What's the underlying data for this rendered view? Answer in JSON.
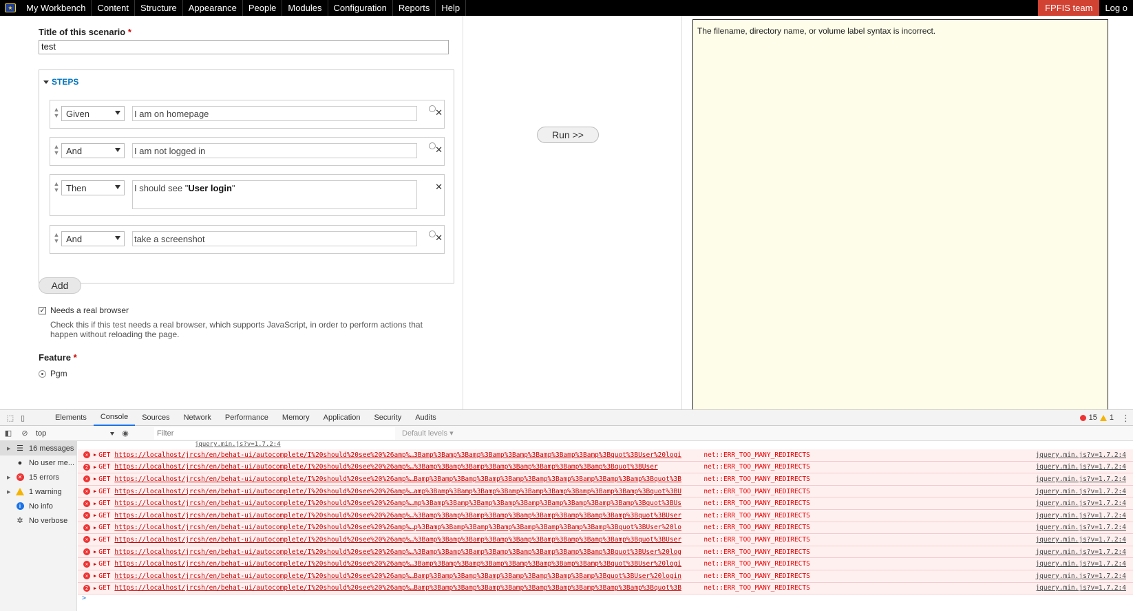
{
  "toolbar": {
    "items": [
      "My Workbench",
      "Content",
      "Structure",
      "Appearance",
      "People",
      "Modules",
      "Configuration",
      "Reports",
      "Help"
    ],
    "team": "FPFIS team",
    "logout": "Log o"
  },
  "form": {
    "title_label": "Title of this scenario",
    "required_mark": "*",
    "title_value": "test",
    "steps_legend": "STEPS",
    "steps": [
      {
        "keyword": "Given",
        "text": "I am on homepage"
      },
      {
        "keyword": "And",
        "text": "I am not logged in"
      },
      {
        "keyword": "Then",
        "text_before": "I should see \"",
        "text_bold": "User login",
        "text_after": "\""
      },
      {
        "keyword": "And",
        "text": "take a screenshot"
      }
    ],
    "add_label": "Add",
    "browser_check_label": "Needs a real browser",
    "browser_desc": "Check this if this test needs a real browser, which supports JavaScript, in order to perform actions that happen without reloading the page.",
    "feature_label": "Feature",
    "feature_option": "Pgm"
  },
  "run_label": "Run >>",
  "output_text": "The filename, directory name, or volume label syntax is incorrect.",
  "devtools": {
    "tabs": [
      "Elements",
      "Console",
      "Sources",
      "Network",
      "Performance",
      "Memory",
      "Application",
      "Security",
      "Audits"
    ],
    "active_tab": "Console",
    "error_count": "15",
    "warning_count": "1",
    "context": "top",
    "filter_placeholder": "Filter",
    "levels": "Default levels ▾",
    "sidebar": [
      {
        "label": "16 messages",
        "icon": "list-icon"
      },
      {
        "label": "No user me...",
        "icon": "user-icon"
      },
      {
        "label": "15 errors",
        "icon": "error-icon"
      },
      {
        "label": "1 warning",
        "icon": "warning-icon"
      },
      {
        "label": "No info",
        "icon": "info-icon"
      },
      {
        "label": "No verbose",
        "icon": "gear-icon"
      }
    ],
    "top_link": "jquery.min.js?v=1.7.2:4",
    "log": [
      {
        "badge": "",
        "url": "https://localhost/jrcsh/en/behat-ui/autocomplete/I%20should%20see%20%26amp%…3Bamp%3Bamp%3Bamp%3Bamp%3Bamp%3Bamp%3Bamp%3Bamp%3Bquot%3BUser%20logi",
        "error": "net::ERR_TOO_MANY_REDIRECTS",
        "src": "jquery.min.js?v=1.7.2:4"
      },
      {
        "badge": "2",
        "url": "https://localhost/jrcsh/en/behat-ui/autocomplete/I%20should%20see%20%26amp%…%3Bamp%3Bamp%3Bamp%3Bamp%3Bamp%3Bamp%3Bamp%3Bamp%3Bquot%3BUser",
        "error": "net::ERR_TOO_MANY_REDIRECTS",
        "src": "jquery.min.js?v=1.7.2:4"
      },
      {
        "badge": "",
        "url": "https://localhost/jrcsh/en/behat-ui/autocomplete/I%20should%20see%20%26amp%…Bamp%3Bamp%3Bamp%3Bamp%3Bamp%3Bamp%3Bamp%3Bamp%3Bamp%3Bamp%3Bquot%3B",
        "error": "net::ERR_TOO_MANY_REDIRECTS",
        "src": "jquery.min.js?v=1.7.2:4"
      },
      {
        "badge": "",
        "url": "https://localhost/jrcsh/en/behat-ui/autocomplete/I%20should%20see%20%26amp%…amp%3Bamp%3Bamp%3Bamp%3Bamp%3Bamp%3Bamp%3Bamp%3Bamp%3Bamp%3Bquot%3BU",
        "error": "net::ERR_TOO_MANY_REDIRECTS",
        "src": "jquery.min.js?v=1.7.2:4"
      },
      {
        "badge": "",
        "url": "https://localhost/jrcsh/en/behat-ui/autocomplete/I%20should%20see%20%26amp%…mp%3Bamp%3Bamp%3Bamp%3Bamp%3Bamp%3Bamp%3Bamp%3Bamp%3Bamp%3Bquot%3BUs",
        "error": "net::ERR_TOO_MANY_REDIRECTS",
        "src": "jquery.min.js?v=1.7.2:4"
      },
      {
        "badge": "",
        "url": "https://localhost/jrcsh/en/behat-ui/autocomplete/I%20should%20see%20%26amp%…%3Bamp%3Bamp%3Bamp%3Bamp%3Bamp%3Bamp%3Bamp%3Bamp%3Bamp%3Bquot%3BUser",
        "error": "net::ERR_TOO_MANY_REDIRECTS",
        "src": "jquery.min.js?v=1.7.2:4"
      },
      {
        "badge": "",
        "url": "https://localhost/jrcsh/en/behat-ui/autocomplete/I%20should%20see%20%26amp%…p%3Bamp%3Bamp%3Bamp%3Bamp%3Bamp%3Bamp%3Bamp%3Bamp%3Bquot%3BUser%20lo",
        "error": "net::ERR_TOO_MANY_REDIRECTS",
        "src": "jquery.min.js?v=1.7.2:4"
      },
      {
        "badge": "",
        "url": "https://localhost/jrcsh/en/behat-ui/autocomplete/I%20should%20see%20%26amp%…%3Bamp%3Bamp%3Bamp%3Bamp%3Bamp%3Bamp%3Bamp%3Bamp%3Bamp%3Bquot%3BUser",
        "error": "net::ERR_TOO_MANY_REDIRECTS",
        "src": "jquery.min.js?v=1.7.2:4"
      },
      {
        "badge": "",
        "url": "https://localhost/jrcsh/en/behat-ui/autocomplete/I%20should%20see%20%26amp%…%3Bamp%3Bamp%3Bamp%3Bamp%3Bamp%3Bamp%3Bamp%3Bamp%3Bquot%3BUser%20log",
        "error": "net::ERR_TOO_MANY_REDIRECTS",
        "src": "jquery.min.js?v=1.7.2:4"
      },
      {
        "badge": "",
        "url": "https://localhost/jrcsh/en/behat-ui/autocomplete/I%20should%20see%20%26amp%…3Bamp%3Bamp%3Bamp%3Bamp%3Bamp%3Bamp%3Bamp%3Bamp%3Bquot%3BUser%20logi",
        "error": "net::ERR_TOO_MANY_REDIRECTS",
        "src": "jquery.min.js?v=1.7.2:4"
      },
      {
        "badge": "",
        "url": "https://localhost/jrcsh/en/behat-ui/autocomplete/I%20should%20see%20%26amp%…Bamp%3Bamp%3Bamp%3Bamp%3Bamp%3Bamp%3Bamp%3Bamp%3Bquot%3BUser%20login",
        "error": "net::ERR_TOO_MANY_REDIRECTS",
        "src": "jquery.min.js?v=1.7.2:4"
      },
      {
        "badge": "2",
        "url": "https://localhost/jrcsh/en/behat-ui/autocomplete/I%20should%20see%20%26amp%…Bamp%3Bamp%3Bamp%3Bamp%3Bamp%3Bamp%3Bamp%3Bamp%3Bamp%3Bamp%3Bquot%3B",
        "error": "net::ERR_TOO_MANY_REDIRECTS",
        "src": "jquery.min.js?v=1.7.2:4"
      }
    ],
    "method": "GET",
    "prompt": ">"
  }
}
